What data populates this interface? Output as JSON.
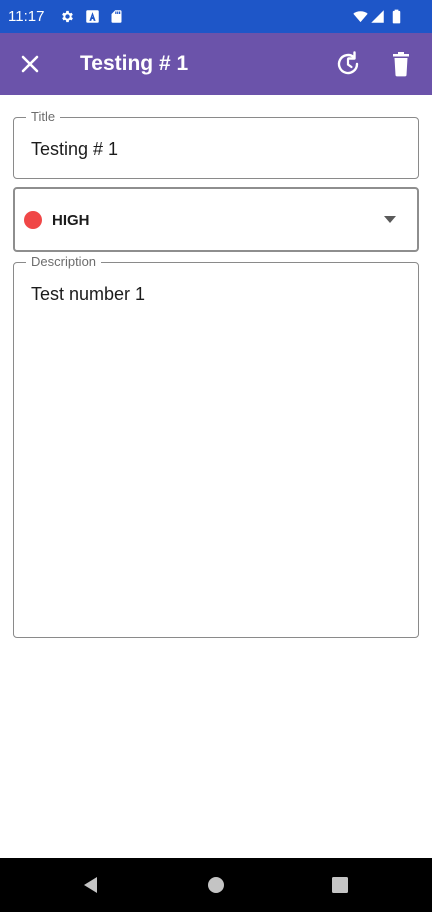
{
  "status_bar": {
    "time": "11:17",
    "background": "#1e56c8",
    "icons": [
      "gear-icon",
      "a-icon",
      "sd-card-icon",
      "wifi-icon",
      "signal-icon",
      "battery-icon"
    ]
  },
  "app_bar": {
    "title": "Testing # 1",
    "background": "#6b53aa",
    "left_icon": "close-icon",
    "right_icons": [
      "history-icon",
      "delete-icon"
    ]
  },
  "form": {
    "title_field": {
      "label": "Title",
      "value": "Testing # 1"
    },
    "priority_select": {
      "selected": "HIGH",
      "dot_color": "#f04747",
      "icon": "dropdown-arrow-icon"
    },
    "description_field": {
      "label": "Description",
      "value": "Test number 1"
    }
  },
  "nav_bar": {
    "buttons": [
      "back-icon",
      "home-icon",
      "recents-icon"
    ]
  }
}
